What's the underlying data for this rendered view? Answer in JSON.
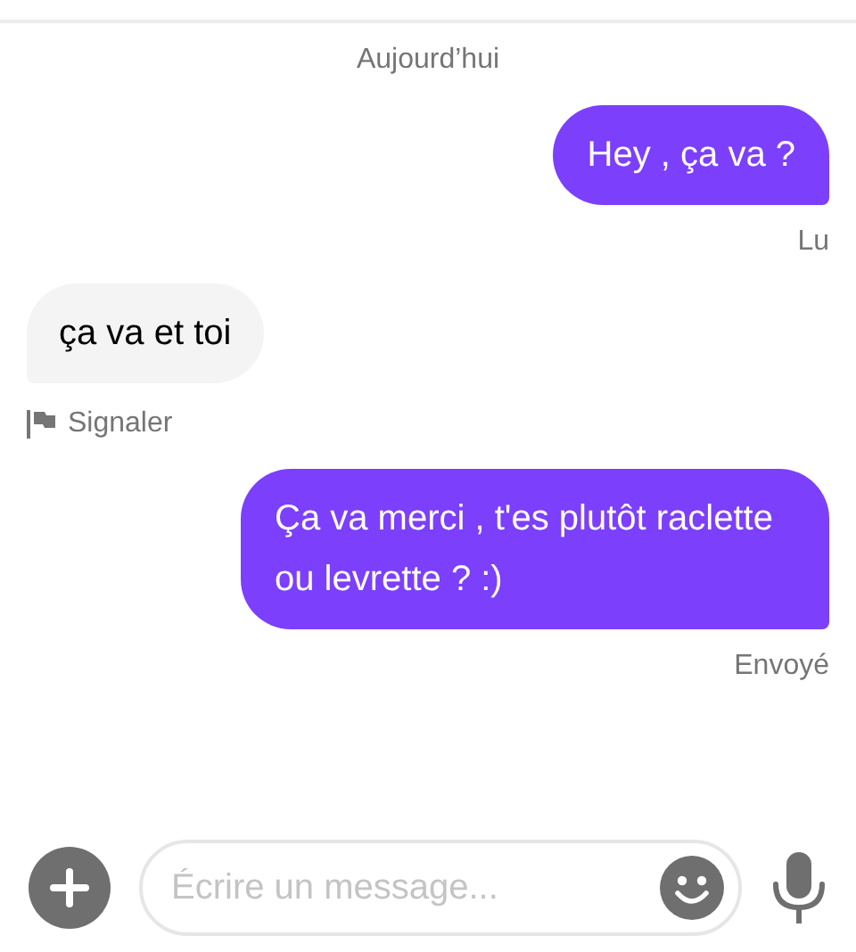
{
  "date_label": "Aujourd’hui",
  "messages": [
    {
      "kind": "sent",
      "text": "Hey , ça va ?",
      "status": "Lu"
    },
    {
      "kind": "received",
      "text": "ça va et toi",
      "action": "Signaler"
    },
    {
      "kind": "sent",
      "text": "Ça va merci , t'es plutôt raclette ou levrette ? :)",
      "status": "Envoyé"
    }
  ],
  "composer": {
    "placeholder": "Écrire un message..."
  }
}
